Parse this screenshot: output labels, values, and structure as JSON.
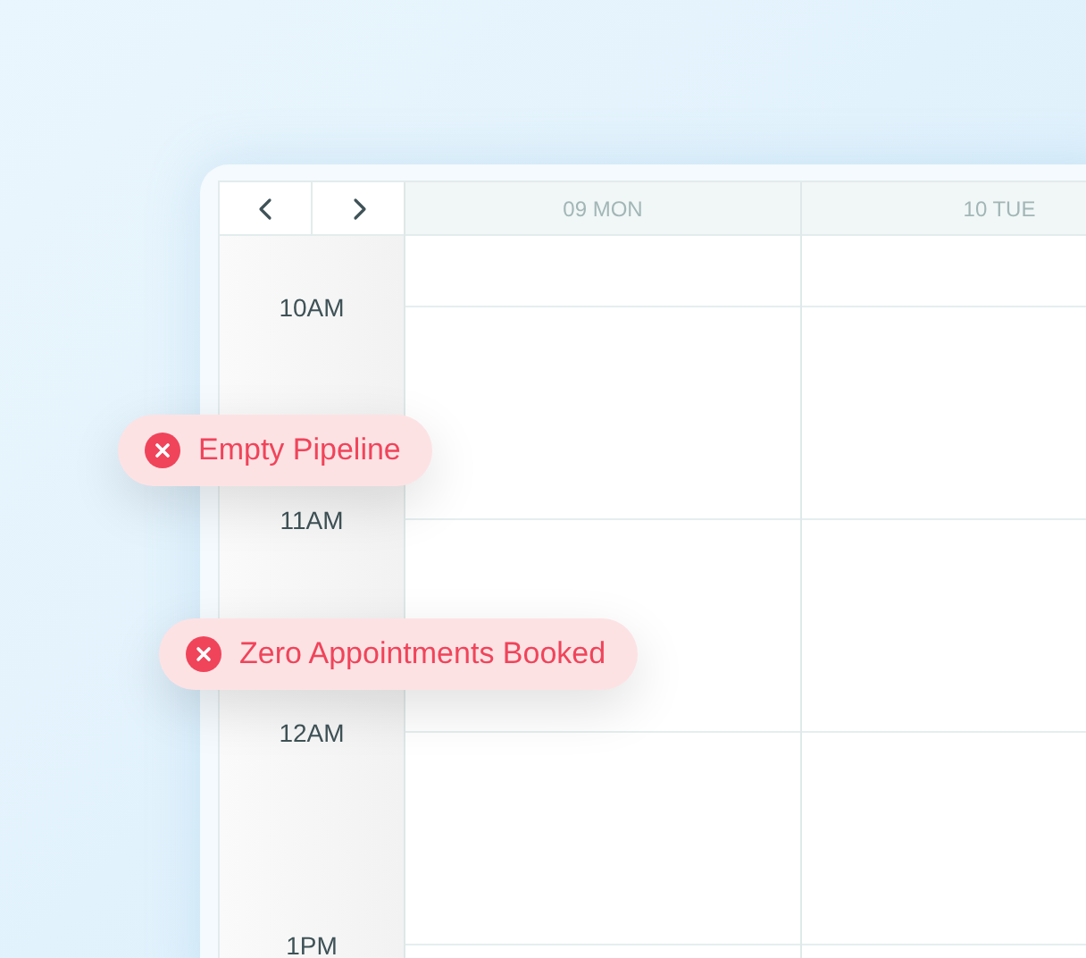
{
  "calendar": {
    "days": [
      {
        "label": "09 MON"
      },
      {
        "label": "10 TUE"
      }
    ],
    "times": [
      "10AM",
      "11AM",
      "12AM",
      "1PM"
    ]
  },
  "alerts": [
    {
      "text": "Empty Pipeline",
      "kind": "error"
    },
    {
      "text": "Zero Appointments Booked",
      "kind": "error"
    }
  ]
}
